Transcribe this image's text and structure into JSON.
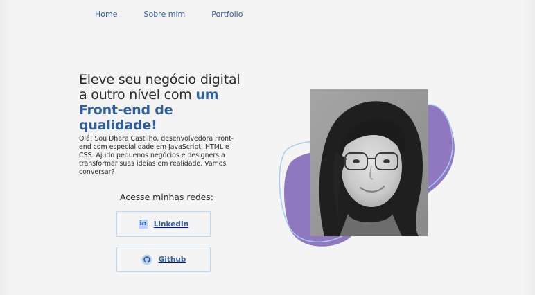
{
  "nav": {
    "items": [
      {
        "label": "Home"
      },
      {
        "label": "Sobre mim"
      },
      {
        "label": "Portfolio"
      }
    ]
  },
  "hero": {
    "title_plain": "Eleve seu negócio digital a outro nível com ",
    "title_highlight": "um Front-end de qualidade!",
    "description": "Olá! Sou Dhara Castilho, desenvolvedora Front-end com especialidade em JavaScript, HTML e CSS. Ajudo pequenos negócios e designers a transformar suas ideias em realidade. Vamos conversar?"
  },
  "socials": {
    "heading": "Acesse minhas redes:",
    "linkedin_label": "LinkedIn",
    "github_label": "Github",
    "linkedin_icon": "linkedin-icon",
    "github_icon": "github-icon"
  },
  "portrait": {
    "photo_icon": "portrait-photo"
  },
  "colors": {
    "accent": "#2f5f9e",
    "button_border": "#b8d6f7",
    "blob_purple": "#8f78c0",
    "outline_blue": "#a6cdf4",
    "background": "#f3f3f3"
  }
}
